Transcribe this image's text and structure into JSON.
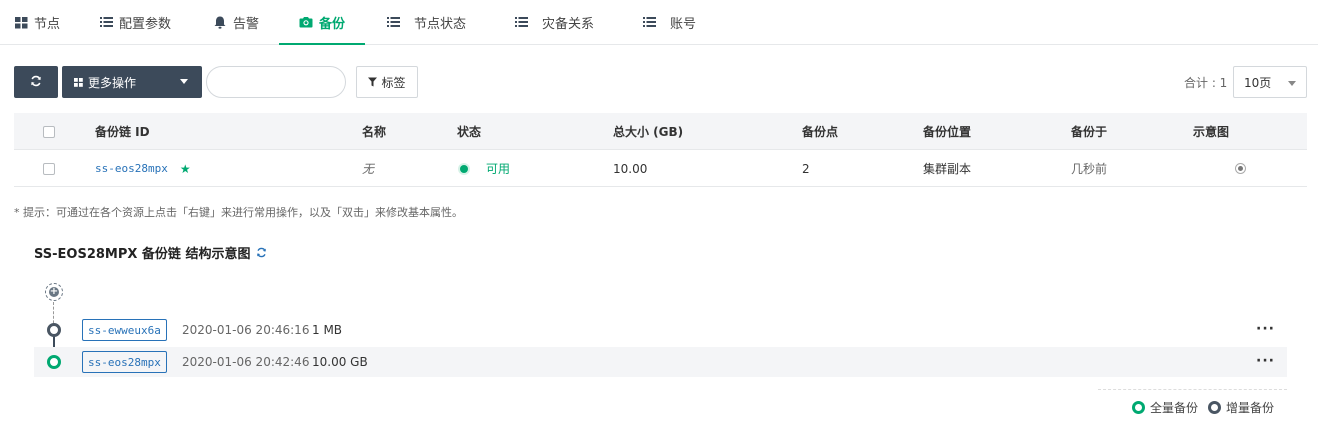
{
  "tabs": [
    {
      "label": "节点",
      "icon": "grid-icon"
    },
    {
      "label": "配置参数",
      "icon": "list-icon"
    },
    {
      "label": "告警",
      "icon": "bell-icon"
    },
    {
      "label": "备份",
      "icon": "camera-icon",
      "active": true
    },
    {
      "label": "节点状态",
      "icon": "list-icon"
    },
    {
      "label": "灾备关系",
      "icon": "list-icon"
    },
    {
      "label": "账号",
      "icon": "list-icon"
    }
  ],
  "toolbar": {
    "more_label": "更多操作",
    "search_placeholder": "",
    "tag_label": "标签",
    "total_label": "合计 : 1",
    "page_size": "10页"
  },
  "table": {
    "headers": [
      "备份链 ID",
      "名称",
      "状态",
      "总大小 (GB)",
      "备份点",
      "备份位置",
      "备份于",
      "示意图"
    ],
    "rows": [
      {
        "id": "ss-eos28mpx",
        "name": "无",
        "status": "可用",
        "size": "10.00",
        "points": "2",
        "location": "集群副本",
        "time": "几秒前"
      }
    ]
  },
  "hint": "* 提示：可通过在各个资源上点击「右键」来进行常用操作，以及「双击」来修改基本属性。",
  "chain": {
    "title": "SS-EOS28MPX 备份链 结构示意图",
    "items": [
      {
        "id": "ss-ewweux6a",
        "time": "2020-01-06 20:46:16",
        "size": "1 MB",
        "more": "···"
      },
      {
        "id": "ss-eos28mpx",
        "time": "2020-01-06 20:42:46",
        "size": "10.00 GB",
        "more": "···"
      }
    ],
    "legend_full": "全量备份",
    "legend_incr": "增量备份"
  },
  "colors": {
    "accent": "#00a971",
    "dark": "#3c4a5a",
    "link": "#2872b8"
  }
}
